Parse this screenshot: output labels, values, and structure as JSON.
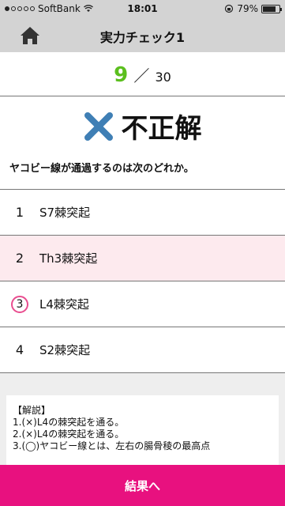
{
  "status_bar": {
    "carrier": "SoftBank",
    "time": "18:01",
    "battery": "79%",
    "battery_level": 0.79
  },
  "nav": {
    "title": "実力チェック1",
    "home_icon": "home-icon"
  },
  "progress": {
    "current": "9",
    "separator": "／",
    "total": "30"
  },
  "result": {
    "icon": "cross-icon",
    "text": "不正解",
    "icon_color": "#3f7fb5"
  },
  "question": "ヤコビー線が通過するのは次のどれか。",
  "options": [
    {
      "num": "1",
      "label": "S7棘突起"
    },
    {
      "num": "2",
      "label": "Th3棘突起"
    },
    {
      "num": "3",
      "label": "L4棘突起"
    },
    {
      "num": "4",
      "label": "S2棘突起"
    }
  ],
  "explanation": {
    "header": "【解説】",
    "lines": [
      "1.(×)L4の棘突起を通る。",
      "2.(×)L4の棘突起を通る。",
      "3.(◯)ヤコビー線とは、左右の腸骨稜の最高点"
    ]
  },
  "footer": {
    "button_label": "結果へ"
  },
  "colors": {
    "accent": "#e8117f",
    "progress_current": "#5bbf1e",
    "highlight": "#fdeaee"
  }
}
